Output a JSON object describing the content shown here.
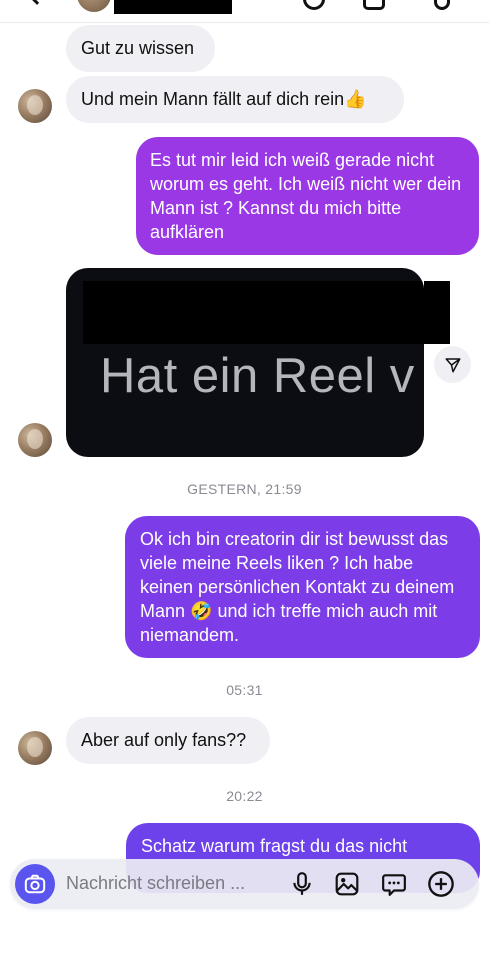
{
  "header": {
    "back_icon": "chevron-left-icon",
    "call_icon": "phone-icon",
    "video_icon": "video-icon",
    "flag_icon": "flag-icon"
  },
  "messages": {
    "m1": "Gut zu wissen",
    "m2": "Und mein Mann fällt auf dich rein👍",
    "m3": "Es tut mir leid ich weiß gerade nicht worum es geht. Ich weiß nicht wer dein Mann ist ? Kannst du mich bitte aufklären",
    "reel_caption": "Hat ein Reel v",
    "stamp1": "GESTERN, 21:59",
    "m4": "Ok ich bin creatorin dir ist bewusst das viele meine Reels liken ? Ich habe keinen persönlichen Kontakt zu deinem Mann 🤣 und ich treffe mich auch mit niemandem.",
    "stamp2": "05:31",
    "m5": "Aber auf only fans??",
    "stamp3": "20:22",
    "m6": "Schatz warum fragst du das nicht"
  },
  "composer": {
    "placeholder": "Nachricht schreiben ...",
    "camera_icon": "camera-icon",
    "mic_icon": "microphone-icon",
    "gallery_icon": "image-icon",
    "sticker_icon": "sticker-icon",
    "plus_icon": "plus-circle-icon"
  },
  "colors": {
    "incoming": "#efeff4",
    "outgoing_1": "#9a38e6",
    "outgoing_2": "#6d42ea",
    "camera_button": "#5b55f0"
  }
}
